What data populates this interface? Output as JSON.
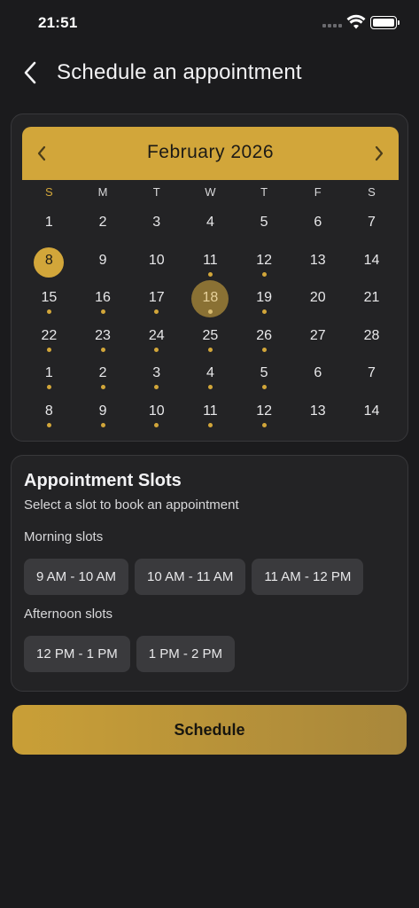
{
  "status_bar": {
    "time": "21:51"
  },
  "header": {
    "title": "Schedule an appointment"
  },
  "calendar": {
    "month_label": "February 2026",
    "weekdays": [
      "S",
      "M",
      "T",
      "W",
      "T",
      "F",
      "S"
    ],
    "weeks": [
      [
        {
          "d": "1",
          "dot": false
        },
        {
          "d": "2",
          "dot": false
        },
        {
          "d": "3",
          "dot": false
        },
        {
          "d": "4",
          "dot": false
        },
        {
          "d": "5",
          "dot": false
        },
        {
          "d": "6",
          "dot": false
        },
        {
          "d": "7",
          "dot": false
        }
      ],
      [
        {
          "d": "8",
          "dot": false,
          "state": "today"
        },
        {
          "d": "9",
          "dot": false
        },
        {
          "d": "10",
          "dot": false
        },
        {
          "d": "11",
          "dot": true
        },
        {
          "d": "12",
          "dot": true
        },
        {
          "d": "13",
          "dot": false
        },
        {
          "d": "14",
          "dot": false
        }
      ],
      [
        {
          "d": "15",
          "dot": true
        },
        {
          "d": "16",
          "dot": true
        },
        {
          "d": "17",
          "dot": true
        },
        {
          "d": "18",
          "dot": true,
          "state": "selected"
        },
        {
          "d": "19",
          "dot": true
        },
        {
          "d": "20",
          "dot": false
        },
        {
          "d": "21",
          "dot": false
        }
      ],
      [
        {
          "d": "22",
          "dot": true
        },
        {
          "d": "23",
          "dot": true
        },
        {
          "d": "24",
          "dot": true
        },
        {
          "d": "25",
          "dot": true
        },
        {
          "d": "26",
          "dot": true
        },
        {
          "d": "27",
          "dot": false
        },
        {
          "d": "28",
          "dot": false
        }
      ],
      [
        {
          "d": "1",
          "dot": true
        },
        {
          "d": "2",
          "dot": true
        },
        {
          "d": "3",
          "dot": true
        },
        {
          "d": "4",
          "dot": true
        },
        {
          "d": "5",
          "dot": true
        },
        {
          "d": "6",
          "dot": false
        },
        {
          "d": "7",
          "dot": false
        }
      ],
      [
        {
          "d": "8",
          "dot": true
        },
        {
          "d": "9",
          "dot": true
        },
        {
          "d": "10",
          "dot": true
        },
        {
          "d": "11",
          "dot": true
        },
        {
          "d": "12",
          "dot": true
        },
        {
          "d": "13",
          "dot": false
        },
        {
          "d": "14",
          "dot": false
        }
      ]
    ]
  },
  "slots": {
    "title": "Appointment Slots",
    "subtitle": "Select a slot to book an appointment",
    "morning_label": "Morning slots",
    "morning": [
      "9 AM - 10 AM",
      "10 AM - 11 AM",
      "11 AM - 12 PM"
    ],
    "afternoon_label": "Afternoon slots",
    "afternoon": [
      "12 PM - 1 PM",
      "1 PM - 2 PM"
    ]
  },
  "actions": {
    "schedule_label": "Schedule"
  },
  "colors": {
    "accent": "#d2a63a",
    "background": "#1b1b1d",
    "card": "#232325",
    "slot": "#3a3a3d"
  }
}
